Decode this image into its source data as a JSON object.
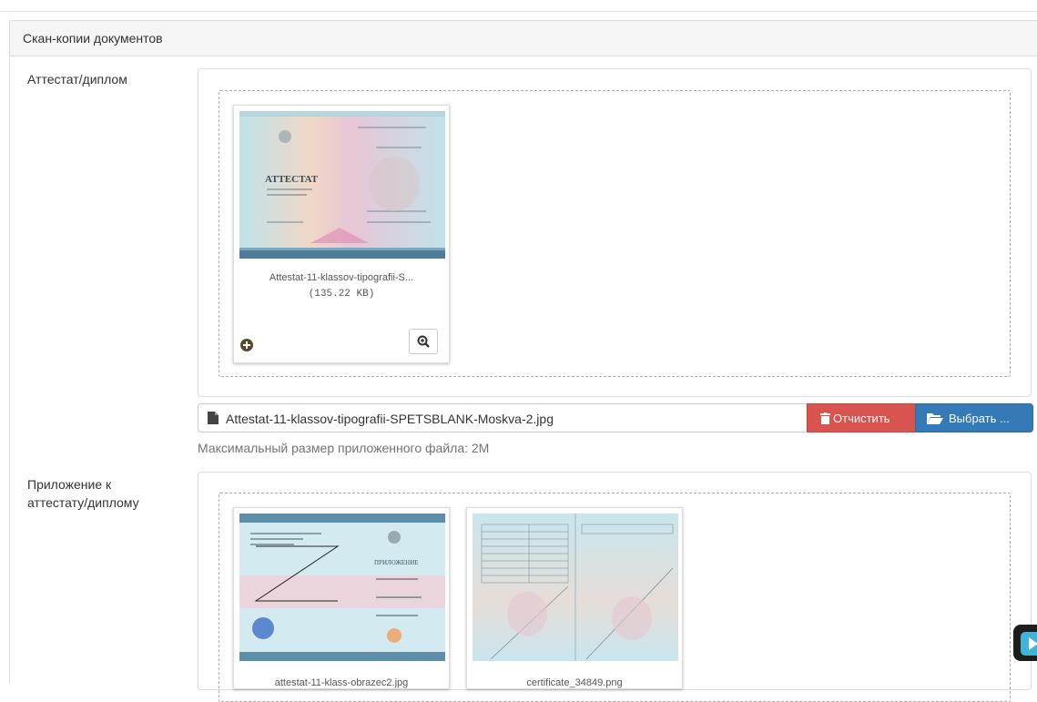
{
  "panel": {
    "title": "Скан-копии документов"
  },
  "diploma": {
    "label": "Аттестат/диплом",
    "files": [
      {
        "caption": "Attestat-11-klassov-tipografii-S...",
        "size": "(135.22 KB)"
      }
    ],
    "input_value": "Attestat-11-klassov-tipografii-SPETSBLANK-Moskva-2.jpg",
    "clear_label": "Отчистить",
    "browse_label": "Выбрать ...",
    "hint": "Максимальный размер приложенного файла: 2M"
  },
  "appendix": {
    "label": "Приложение к аттестату/диплому",
    "files": [
      {
        "caption": "attestat-11-klass-obrazec2.jpg"
      },
      {
        "caption": "certificate_34849.png"
      }
    ]
  },
  "icons": {
    "file": "file-icon",
    "trash": "trash-icon",
    "folder": "folder-open-icon",
    "zoom": "zoom-in-icon",
    "drag": "plus-circle-icon"
  },
  "colors": {
    "danger": "#d9534f",
    "primary": "#337ab7",
    "muted": "#737373"
  }
}
